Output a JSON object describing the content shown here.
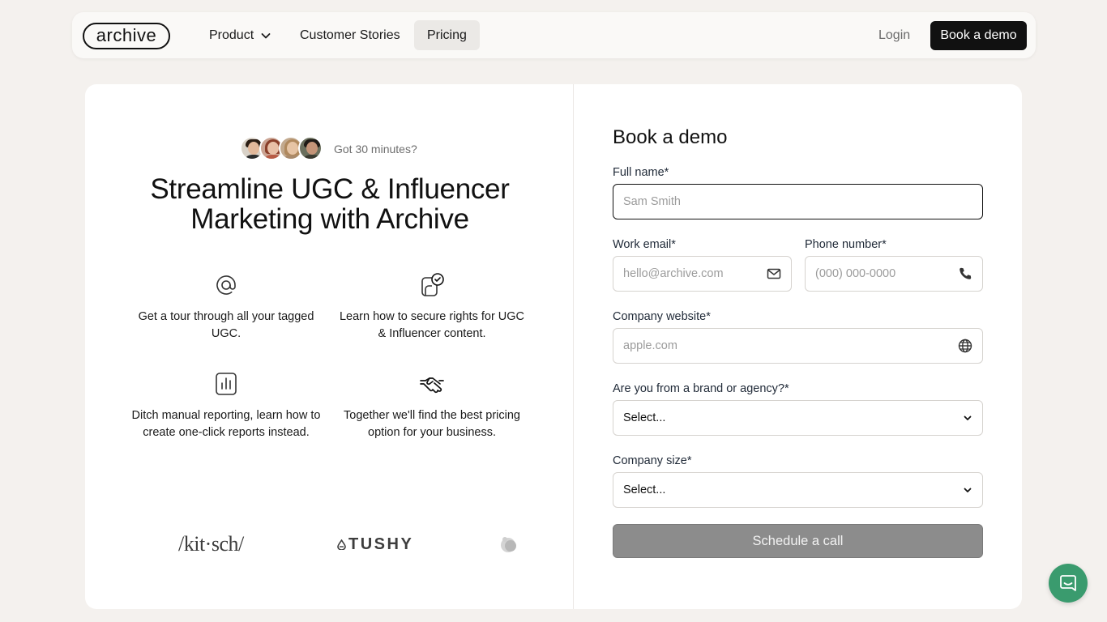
{
  "nav": {
    "logo": "archive",
    "product": "Product",
    "customer_stories": "Customer Stories",
    "pricing": "Pricing",
    "login": "Login",
    "cta": "Book a demo"
  },
  "hero": {
    "got_minutes": "Got 30 minutes?",
    "headline": "Streamline UGC & Influencer Marketing with Archive"
  },
  "features": [
    {
      "icon": "at-sign-icon",
      "text": "Get a tour through all your tagged UGC."
    },
    {
      "icon": "rights-check-icon",
      "text": "Learn how to secure rights for UGC & Influencer content."
    },
    {
      "icon": "bar-chart-icon",
      "text": "Ditch manual reporting, learn how to create one-click reports instead."
    },
    {
      "icon": "handshake-icon",
      "text": "Together we'll find the best pricing option for your business."
    }
  ],
  "brands": {
    "kitsch": "/kit·sch/",
    "tushy": "TUSHY"
  },
  "form": {
    "title": "Book a demo",
    "full_name": {
      "label": "Full name*",
      "placeholder": "Sam Smith"
    },
    "work_email": {
      "label": "Work email*",
      "placeholder": "hello@archive.com"
    },
    "phone": {
      "label": "Phone number*",
      "placeholder": "(000) 000-0000"
    },
    "website": {
      "label": "Company website*",
      "placeholder": "apple.com"
    },
    "brand_or_agency": {
      "label": "Are you from a brand or agency?*",
      "value": "Select..."
    },
    "company_size": {
      "label": "Company size*",
      "value": "Select..."
    },
    "submit": "Schedule a call"
  },
  "colors": {
    "background": "#f4f1ee",
    "cta": "#111111",
    "submit_disabled": "#8c8c8c",
    "chat": "#3a9b6e"
  }
}
